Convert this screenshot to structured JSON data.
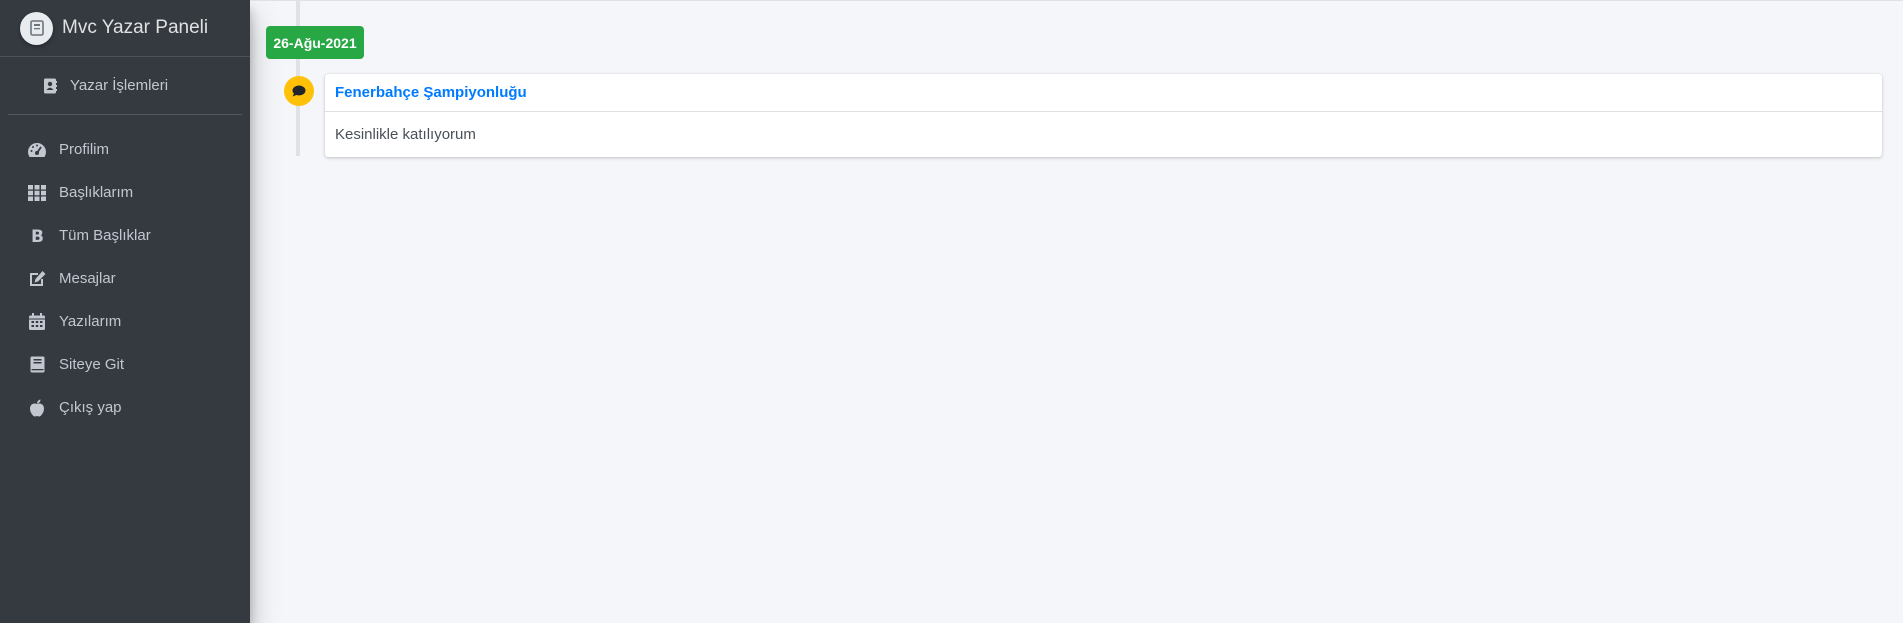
{
  "brand": {
    "title": "Mvc Yazar Paneli",
    "logo_icon": "book-logo-icon"
  },
  "user_panel": {
    "label": "Yazar İşlemleri",
    "icon": "address-book-icon"
  },
  "nav": {
    "items": [
      {
        "label": "Profilim",
        "icon": "tachometer-icon"
      },
      {
        "label": "Başlıklarım",
        "icon": "grid-icon"
      },
      {
        "label": "Tüm Başlıklar",
        "icon": "bold-icon"
      },
      {
        "label": "Mesajlar",
        "icon": "edit-icon"
      },
      {
        "label": "Yazılarım",
        "icon": "calendar-icon"
      },
      {
        "label": "Siteye Git",
        "icon": "book-icon"
      },
      {
        "label": "Çıkış yap",
        "icon": "apple-icon"
      }
    ]
  },
  "timeline": {
    "date_label": "26-Ağu-2021",
    "item": {
      "icon": "comment-icon",
      "title": "Fenerbahçe Şampiyonluğu",
      "body": "Kesinlikle katılıyorum"
    }
  },
  "colors": {
    "sidebar_bg": "#343a40",
    "time_label": "#28a745",
    "timeline_icon": "#ffc107",
    "link": "#007bff",
    "content_bg": "#f4f6f9"
  }
}
